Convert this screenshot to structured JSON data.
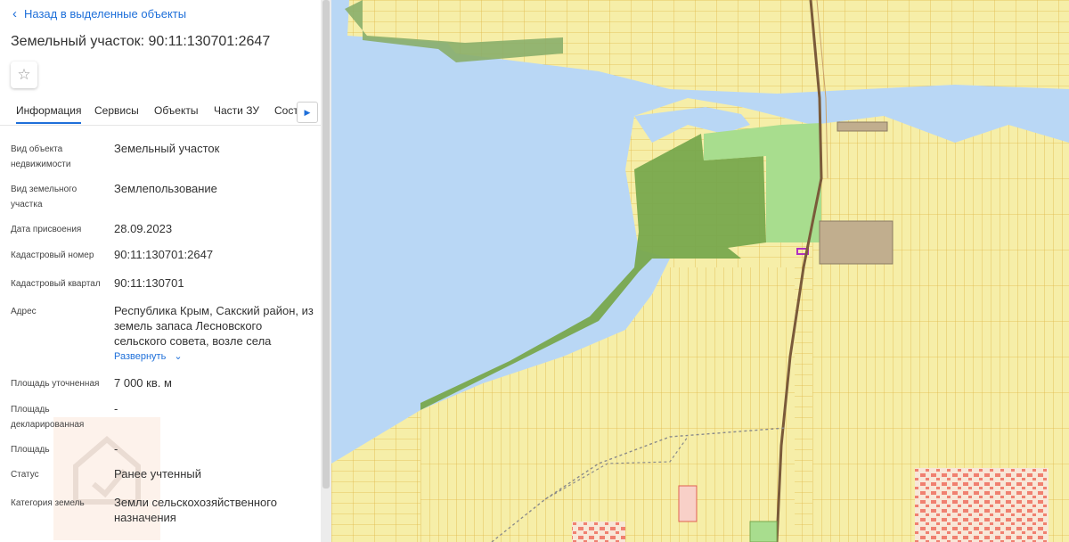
{
  "panel": {
    "back_label": "Назад в выделенные объекты",
    "title": "Земельный участок: 90:11:130701:2647",
    "tabs": [
      "Информация",
      "Сервисы",
      "Объекты",
      "Части ЗУ",
      "Составн"
    ],
    "fields": [
      {
        "label": "Вид объекта недвижимости",
        "value": "Земельный участок"
      },
      {
        "label": "Вид земельного участка",
        "value": "Землепользование"
      },
      {
        "label": "Дата присвоения",
        "value": "28.09.2023"
      },
      {
        "label": "Кадастровый номер",
        "value": "90:11:130701:2647"
      },
      {
        "label": "Кадастровый квартал",
        "value": "90:11:130701"
      },
      {
        "label": "Адрес",
        "value": "Республика Крым, Сакский район, из земель запаса Лесновского сельского совета, возле села"
      },
      {
        "label": "Площадь уточненная",
        "value": "7 000 кв. м"
      },
      {
        "label": "Площадь декларированная",
        "value": "-"
      },
      {
        "label": "Площадь",
        "value": "-"
      },
      {
        "label": "Статус",
        "value": "Ранее учтенный"
      },
      {
        "label": "Категория земель",
        "value": "Земли сельскохозяйственного назначения"
      }
    ],
    "expand_label": "Развернуть"
  },
  "icons": [
    "chevron-left-icon",
    "star-icon",
    "chevron-right-icon",
    "chevron-down-icon"
  ],
  "colors": {
    "accent": "#1e6fd9",
    "water": "#b9d7f5",
    "parcel": "#f6eea8",
    "parcel_line": "#e0b84a",
    "forest_dark": "#78a84d",
    "forest_light": "#a8dd8e",
    "building": "#f08070",
    "brown_plot": "#c1ae8e"
  }
}
